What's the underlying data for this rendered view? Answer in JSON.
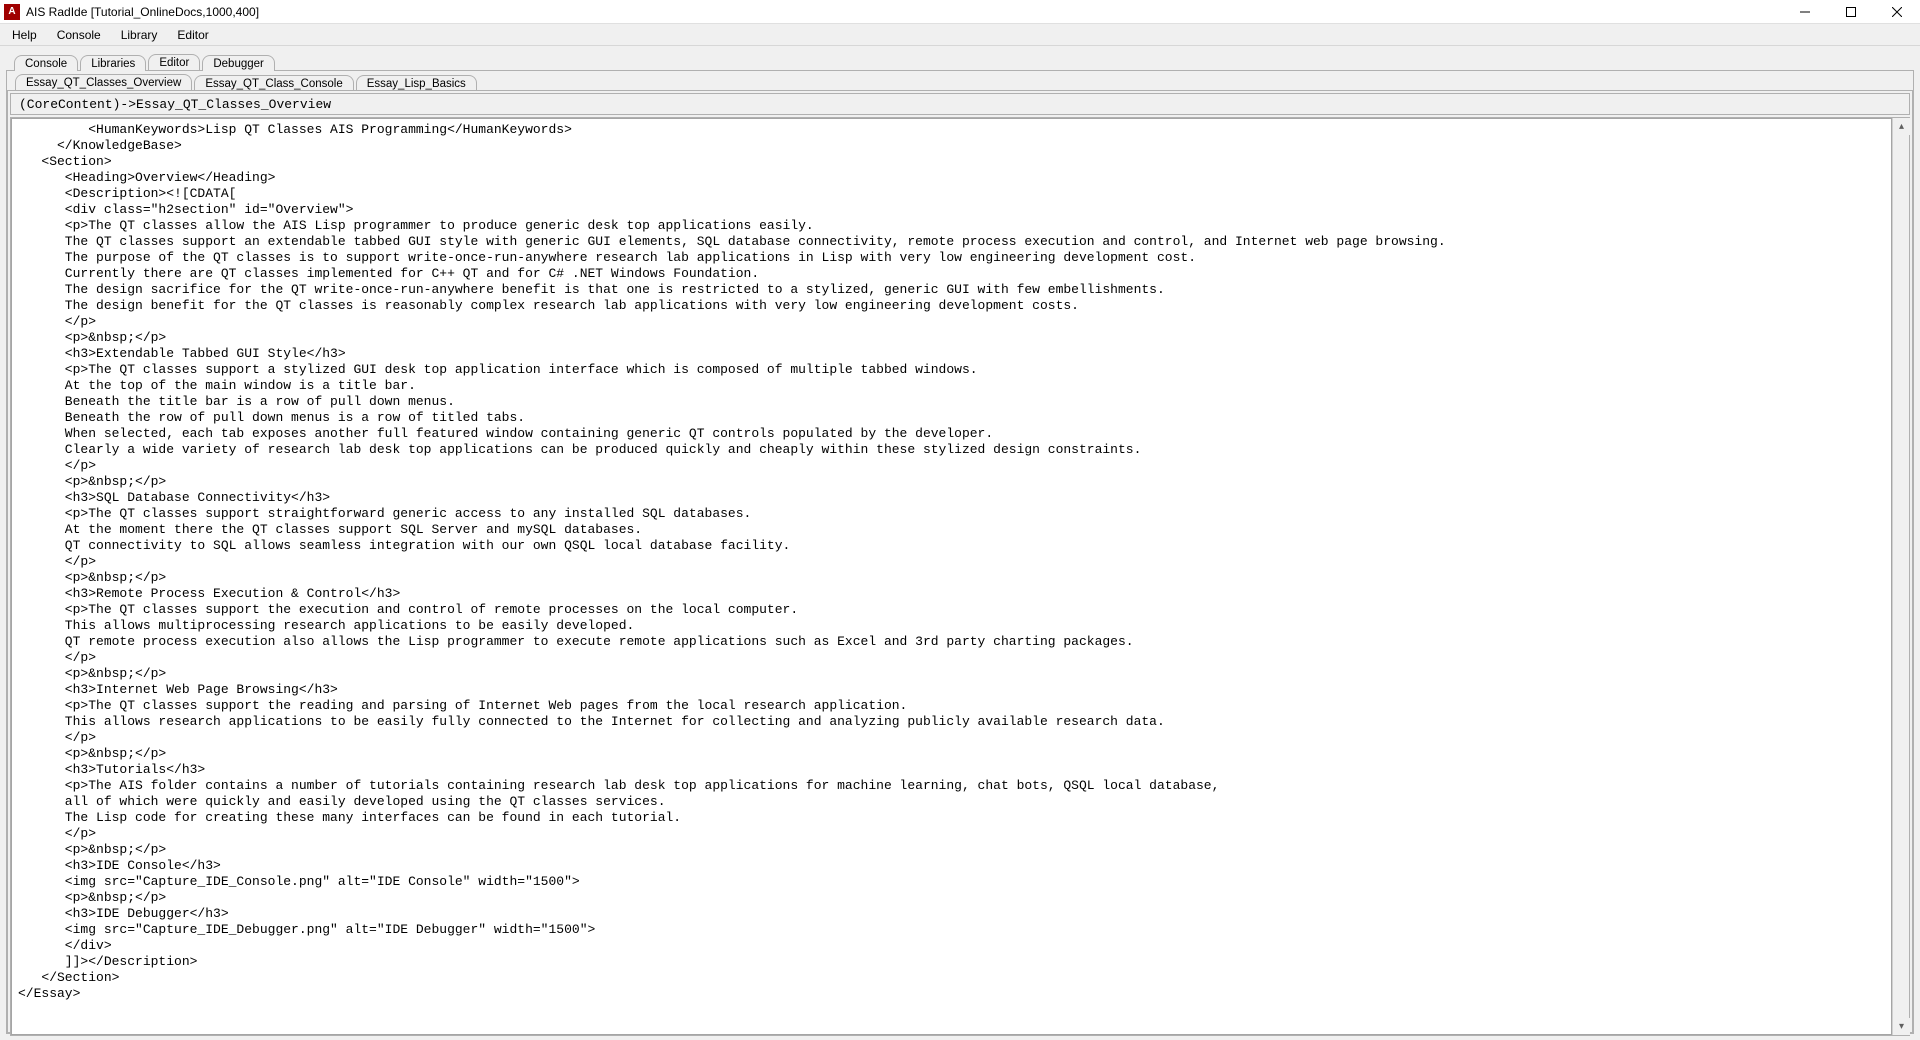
{
  "window": {
    "title": "AIS RadIde [Tutorial_OnlineDocs,1000,400]"
  },
  "menubar": [
    "Help",
    "Console",
    "Library",
    "Editor"
  ],
  "main_tabs": {
    "items": [
      "Console",
      "Libraries",
      "Editor",
      "Debugger"
    ],
    "active_index": 2
  },
  "sub_tabs": {
    "items": [
      "Essay_QT_Classes_Overview",
      "Essay_QT_Class_Console",
      "Essay_Lisp_Basics"
    ],
    "active_index": 0
  },
  "breadcrumb": "(CoreContent)->Essay_QT_Classes_Overview",
  "editor_content": "         <HumanKeywords>Lisp QT Classes AIS Programming</HumanKeywords>\n     </KnowledgeBase>\n   <Section>\n      <Heading>Overview</Heading>\n      <Description><![CDATA[\n      <div class=\"h2section\" id=\"Overview\">\n      <p>The QT classes allow the AIS Lisp programmer to produce generic desk top applications easily.\n      The QT classes support an extendable tabbed GUI style with generic GUI elements, SQL database connectivity, remote process execution and control, and Internet web page browsing.\n      The purpose of the QT classes is to support write-once-run-anywhere research lab applications in Lisp with very low engineering development cost.\n      Currently there are QT classes implemented for C++ QT and for C# .NET Windows Foundation.\n      The design sacrifice for the QT write-once-run-anywhere benefit is that one is restricted to a stylized, generic GUI with few embellishments.\n      The design benefit for the QT classes is reasonably complex research lab applications with very low engineering development costs.\n      </p>\n      <p>&nbsp;</p>\n      <h3>Extendable Tabbed GUI Style</h3>\n      <p>The QT classes support a stylized GUI desk top application interface which is composed of multiple tabbed windows.\n      At the top of the main window is a title bar.\n      Beneath the title bar is a row of pull down menus.\n      Beneath the row of pull down menus is a row of titled tabs.\n      When selected, each tab exposes another full featured window containing generic QT controls populated by the developer.\n      Clearly a wide variety of research lab desk top applications can be produced quickly and cheaply within these stylized design constraints.\n      </p>\n      <p>&nbsp;</p>\n      <h3>SQL Database Connectivity</h3>\n      <p>The QT classes support straightforward generic access to any installed SQL databases.\n      At the moment there the QT classes support SQL Server and mySQL databases.\n      QT connectivity to SQL allows seamless integration with our own QSQL local database facility.\n      </p>\n      <p>&nbsp;</p>\n      <h3>Remote Process Execution & Control</h3>\n      <p>The QT classes support the execution and control of remote processes on the local computer.\n      This allows multiprocessing research applications to be easily developed.\n      QT remote process execution also allows the Lisp programmer to execute remote applications such as Excel and 3rd party charting packages.\n      </p>\n      <p>&nbsp;</p>\n      <h3>Internet Web Page Browsing</h3>\n      <p>The QT classes support the reading and parsing of Internet Web pages from the local research application.\n      This allows research applications to be easily fully connected to the Internet for collecting and analyzing publicly available research data.\n      </p>\n      <p>&nbsp;</p>\n      <h3>Tutorials</h3>\n      <p>The AIS folder contains a number of tutorials containing research lab desk top applications for machine learning, chat bots, QSQL local database,\n      all of which were quickly and easily developed using the QT classes services.\n      The Lisp code for creating these many interfaces can be found in each tutorial.\n      </p>\n      <p>&nbsp;</p>\n      <h3>IDE Console</h3>\n      <img src=\"Capture_IDE_Console.png\" alt=\"IDE Console\" width=\"1500\">\n      <p>&nbsp;</p>\n      <h3>IDE Debugger</h3>\n      <img src=\"Capture_IDE_Debugger.png\" alt=\"IDE Debugger\" width=\"1500\">\n      </div>\n      ]]></Description>\n   </Section>\n</Essay>"
}
